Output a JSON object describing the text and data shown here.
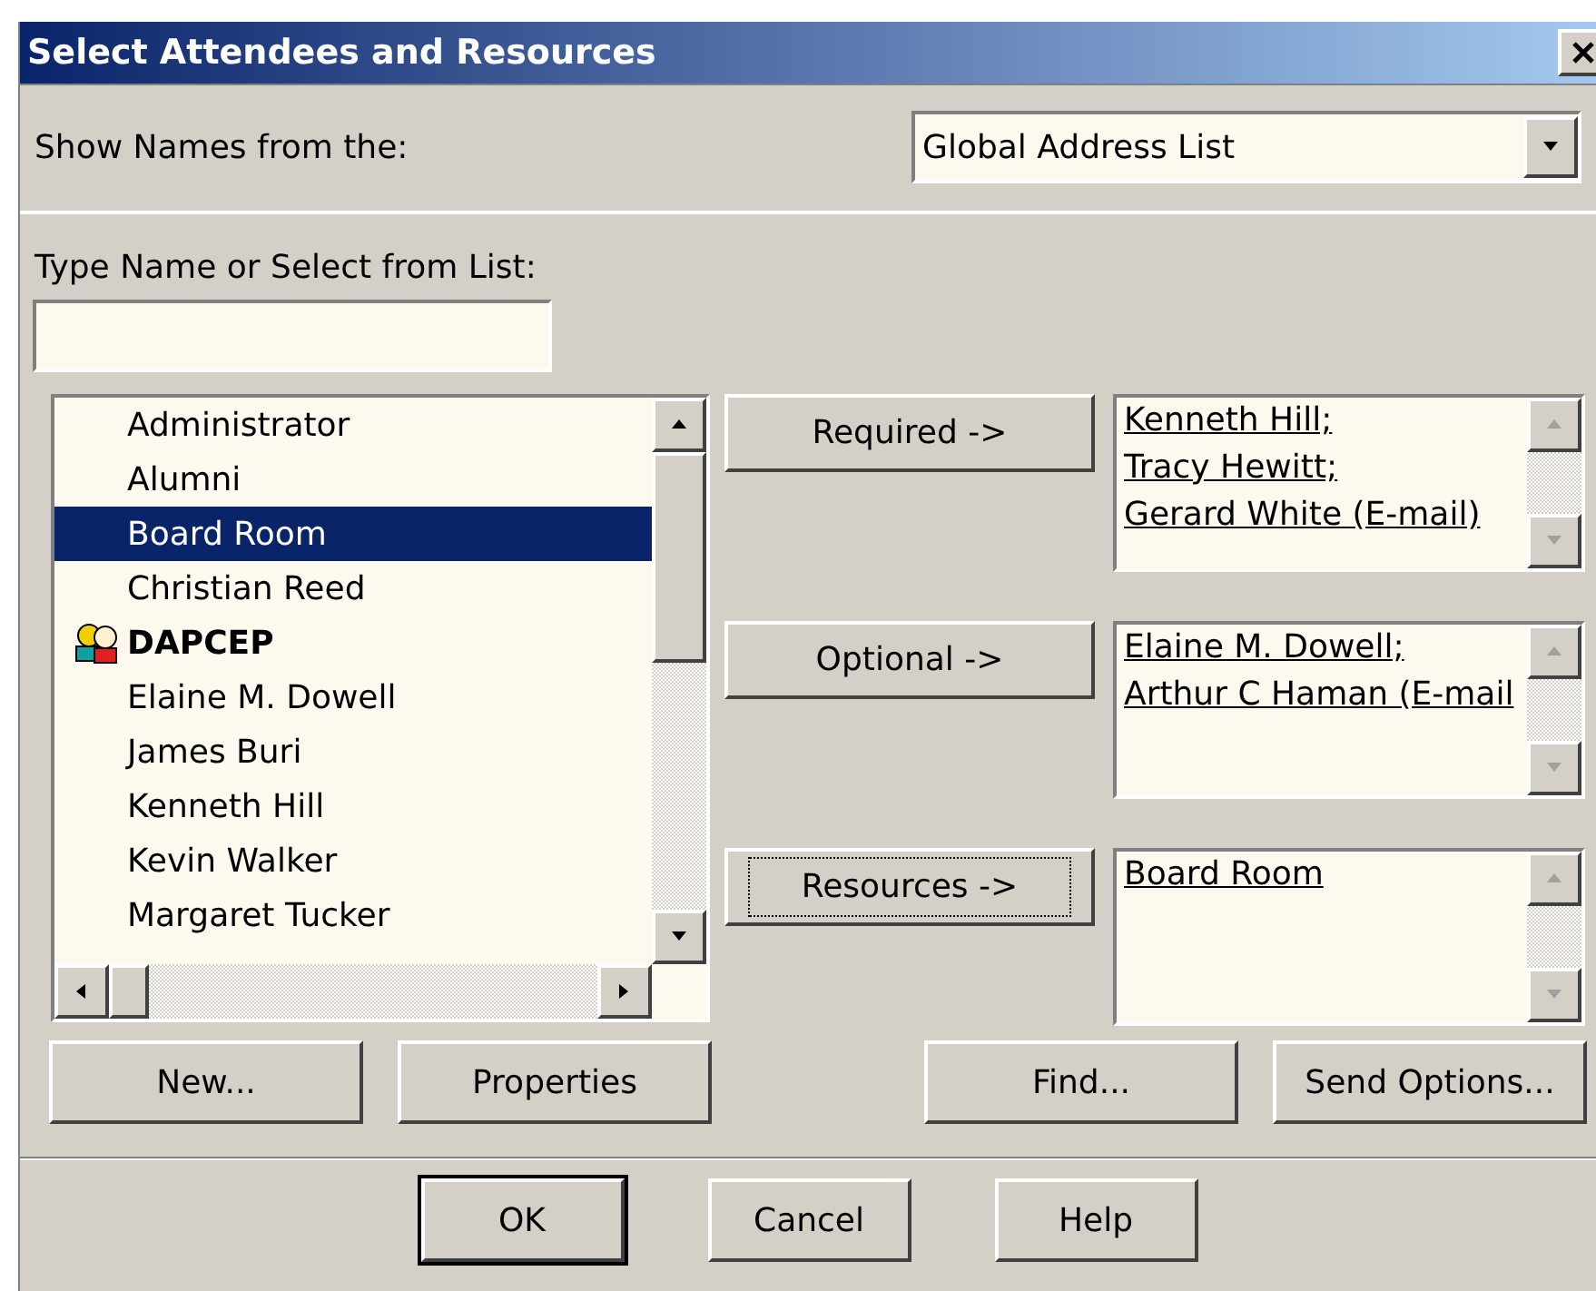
{
  "window": {
    "title": "Select Attendees and Resources"
  },
  "show_names": {
    "label": "Show Names from the:",
    "value": "Global Address List"
  },
  "type_name": {
    "label": "Type Name or Select from List:"
  },
  "names": [
    {
      "name": "Administrator",
      "kind": "person",
      "selected": false
    },
    {
      "name": "Alumni",
      "kind": "person",
      "selected": false
    },
    {
      "name": "Board Room",
      "kind": "person",
      "selected": true
    },
    {
      "name": "Christian Reed",
      "kind": "person",
      "selected": false
    },
    {
      "name": "DAPCEP",
      "kind": "group",
      "selected": false
    },
    {
      "name": "Elaine M. Dowell",
      "kind": "person",
      "selected": false
    },
    {
      "name": "James Buri",
      "kind": "person",
      "selected": false
    },
    {
      "name": "Kenneth Hill",
      "kind": "person",
      "selected": false
    },
    {
      "name": "Kevin Walker",
      "kind": "person",
      "selected": false
    },
    {
      "name": "Margaret Tucker",
      "kind": "person",
      "selected": false
    }
  ],
  "recipients": [
    {
      "button": "Required ->",
      "focused": false,
      "entries": [
        "Kenneth Hill;",
        "Tracy Hewitt;",
        "Gerard White (E-mail)"
      ]
    },
    {
      "button": "Optional ->",
      "focused": false,
      "entries": [
        "Elaine M. Dowell;",
        "Arthur C Haman (E-mail"
      ]
    },
    {
      "button": "Resources ->",
      "focused": true,
      "entries": [
        "Board Room"
      ]
    }
  ],
  "action_buttons": [
    "New...",
    "Properties",
    "Find...",
    "Send Options..."
  ],
  "dialog_buttons": [
    {
      "label": "OK",
      "default": true
    },
    {
      "label": "Cancel",
      "default": false
    },
    {
      "label": "Help",
      "default": false
    }
  ]
}
